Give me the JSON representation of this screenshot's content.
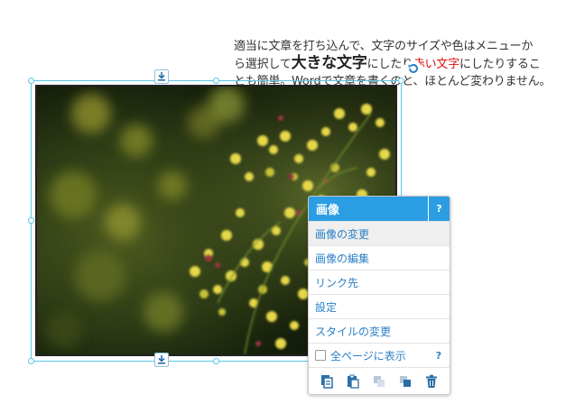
{
  "paragraph": {
    "line1": "適当に文章を打ち込んで、文字のサイズや色はメニューか",
    "line2_pre": "ら選択して",
    "line2_big": "大きな文字",
    "line2_mid": "にしたり",
    "line2_red": "赤い文字",
    "line2_post": "にしたりするこ",
    "line3": "とも簡単。Wordで文章を書くのと、ほとんど変わりません。"
  },
  "menu": {
    "title": "画像",
    "help": "?",
    "items": [
      {
        "label": "画像の変更"
      },
      {
        "label": "画像の編集"
      },
      {
        "label": "リンク先"
      },
      {
        "label": "設定"
      },
      {
        "label": "スタイルの変更"
      }
    ],
    "show_all_pages": "全ページに表示",
    "show_all_help": "?"
  },
  "colors": {
    "accent": "#2b9de3",
    "link": "#2a7fc6",
    "red_text": "#dd1111",
    "selection": "#5cc6e6"
  },
  "icons": {
    "anchor_top": "download-icon",
    "anchor_bottom": "download-icon",
    "rotate": "rotate-icon",
    "tools": [
      "copy-icon",
      "paste-icon",
      "send-backward-icon",
      "bring-forward-icon",
      "trash-icon"
    ]
  }
}
